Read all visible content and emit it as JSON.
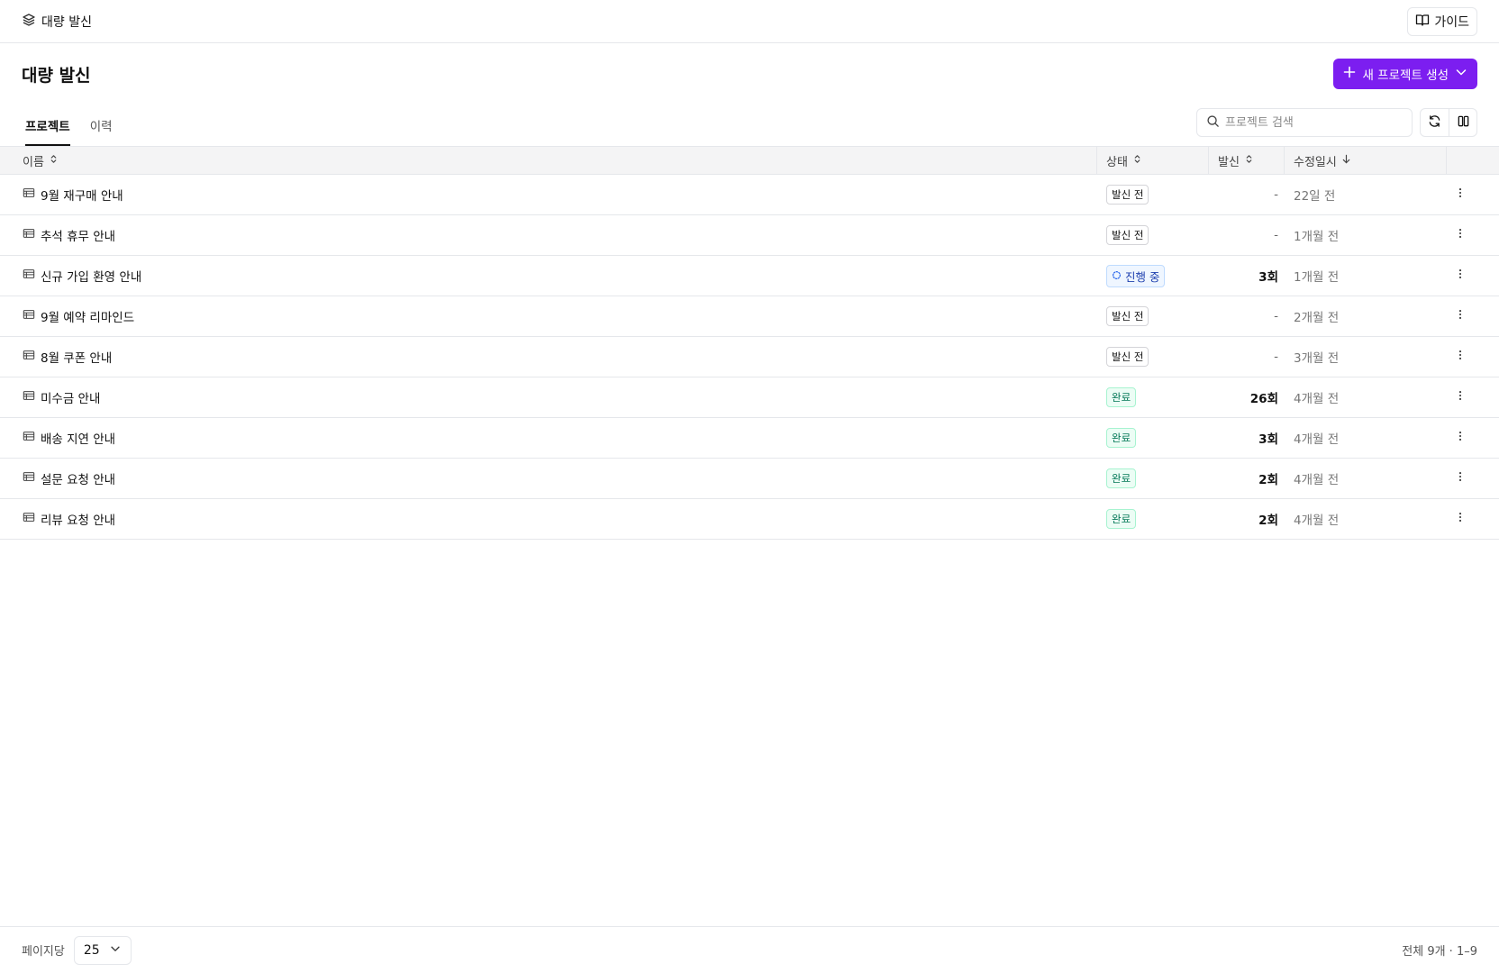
{
  "topbar": {
    "brand_label": "대량 발신",
    "guide_label": "가이드"
  },
  "header": {
    "title": "대량 발신",
    "create_label": "새 프로젝트 생성"
  },
  "tabs": [
    {
      "label": "프로젝트",
      "active": true
    },
    {
      "label": "이력",
      "active": false
    }
  ],
  "search": {
    "placeholder": "프로젝트 검색"
  },
  "columns": {
    "name": "이름",
    "status": "상태",
    "send": "발신",
    "modified": "수정일시"
  },
  "rows": [
    {
      "name": "9월 재구매 안내",
      "status": "발신 전",
      "status_kind": "pending",
      "sends": "-",
      "modified": "22일 전"
    },
    {
      "name": "추석 휴무 안내",
      "status": "발신 전",
      "status_kind": "pending",
      "sends": "-",
      "modified": "1개월 전"
    },
    {
      "name": "신규 가입 환영 안내",
      "status": "진행 중",
      "status_kind": "progress",
      "sends": "3회",
      "modified": "1개월 전"
    },
    {
      "name": "9월 예약 리마인드",
      "status": "발신 전",
      "status_kind": "pending",
      "sends": "-",
      "modified": "2개월 전"
    },
    {
      "name": "8월 쿠폰 안내",
      "status": "발신 전",
      "status_kind": "pending",
      "sends": "-",
      "modified": "3개월 전"
    },
    {
      "name": "미수금 안내",
      "status": "완료",
      "status_kind": "done",
      "sends": "26회",
      "modified": "4개월 전"
    },
    {
      "name": "배송 지연 안내",
      "status": "완료",
      "status_kind": "done",
      "sends": "3회",
      "modified": "4개월 전"
    },
    {
      "name": "설문 요청 안내",
      "status": "완료",
      "status_kind": "done",
      "sends": "2회",
      "modified": "4개월 전"
    },
    {
      "name": "리뷰 요청 안내",
      "status": "완료",
      "status_kind": "done",
      "sends": "2회",
      "modified": "4개월 전"
    }
  ],
  "footer": {
    "per_page_label": "페이지당",
    "per_page_value": "25",
    "total_label": "전체 9개 · 1–9"
  },
  "colors": {
    "accent": "#7c1ef0",
    "progress_text": "#1e40af",
    "done_text": "#047857"
  }
}
